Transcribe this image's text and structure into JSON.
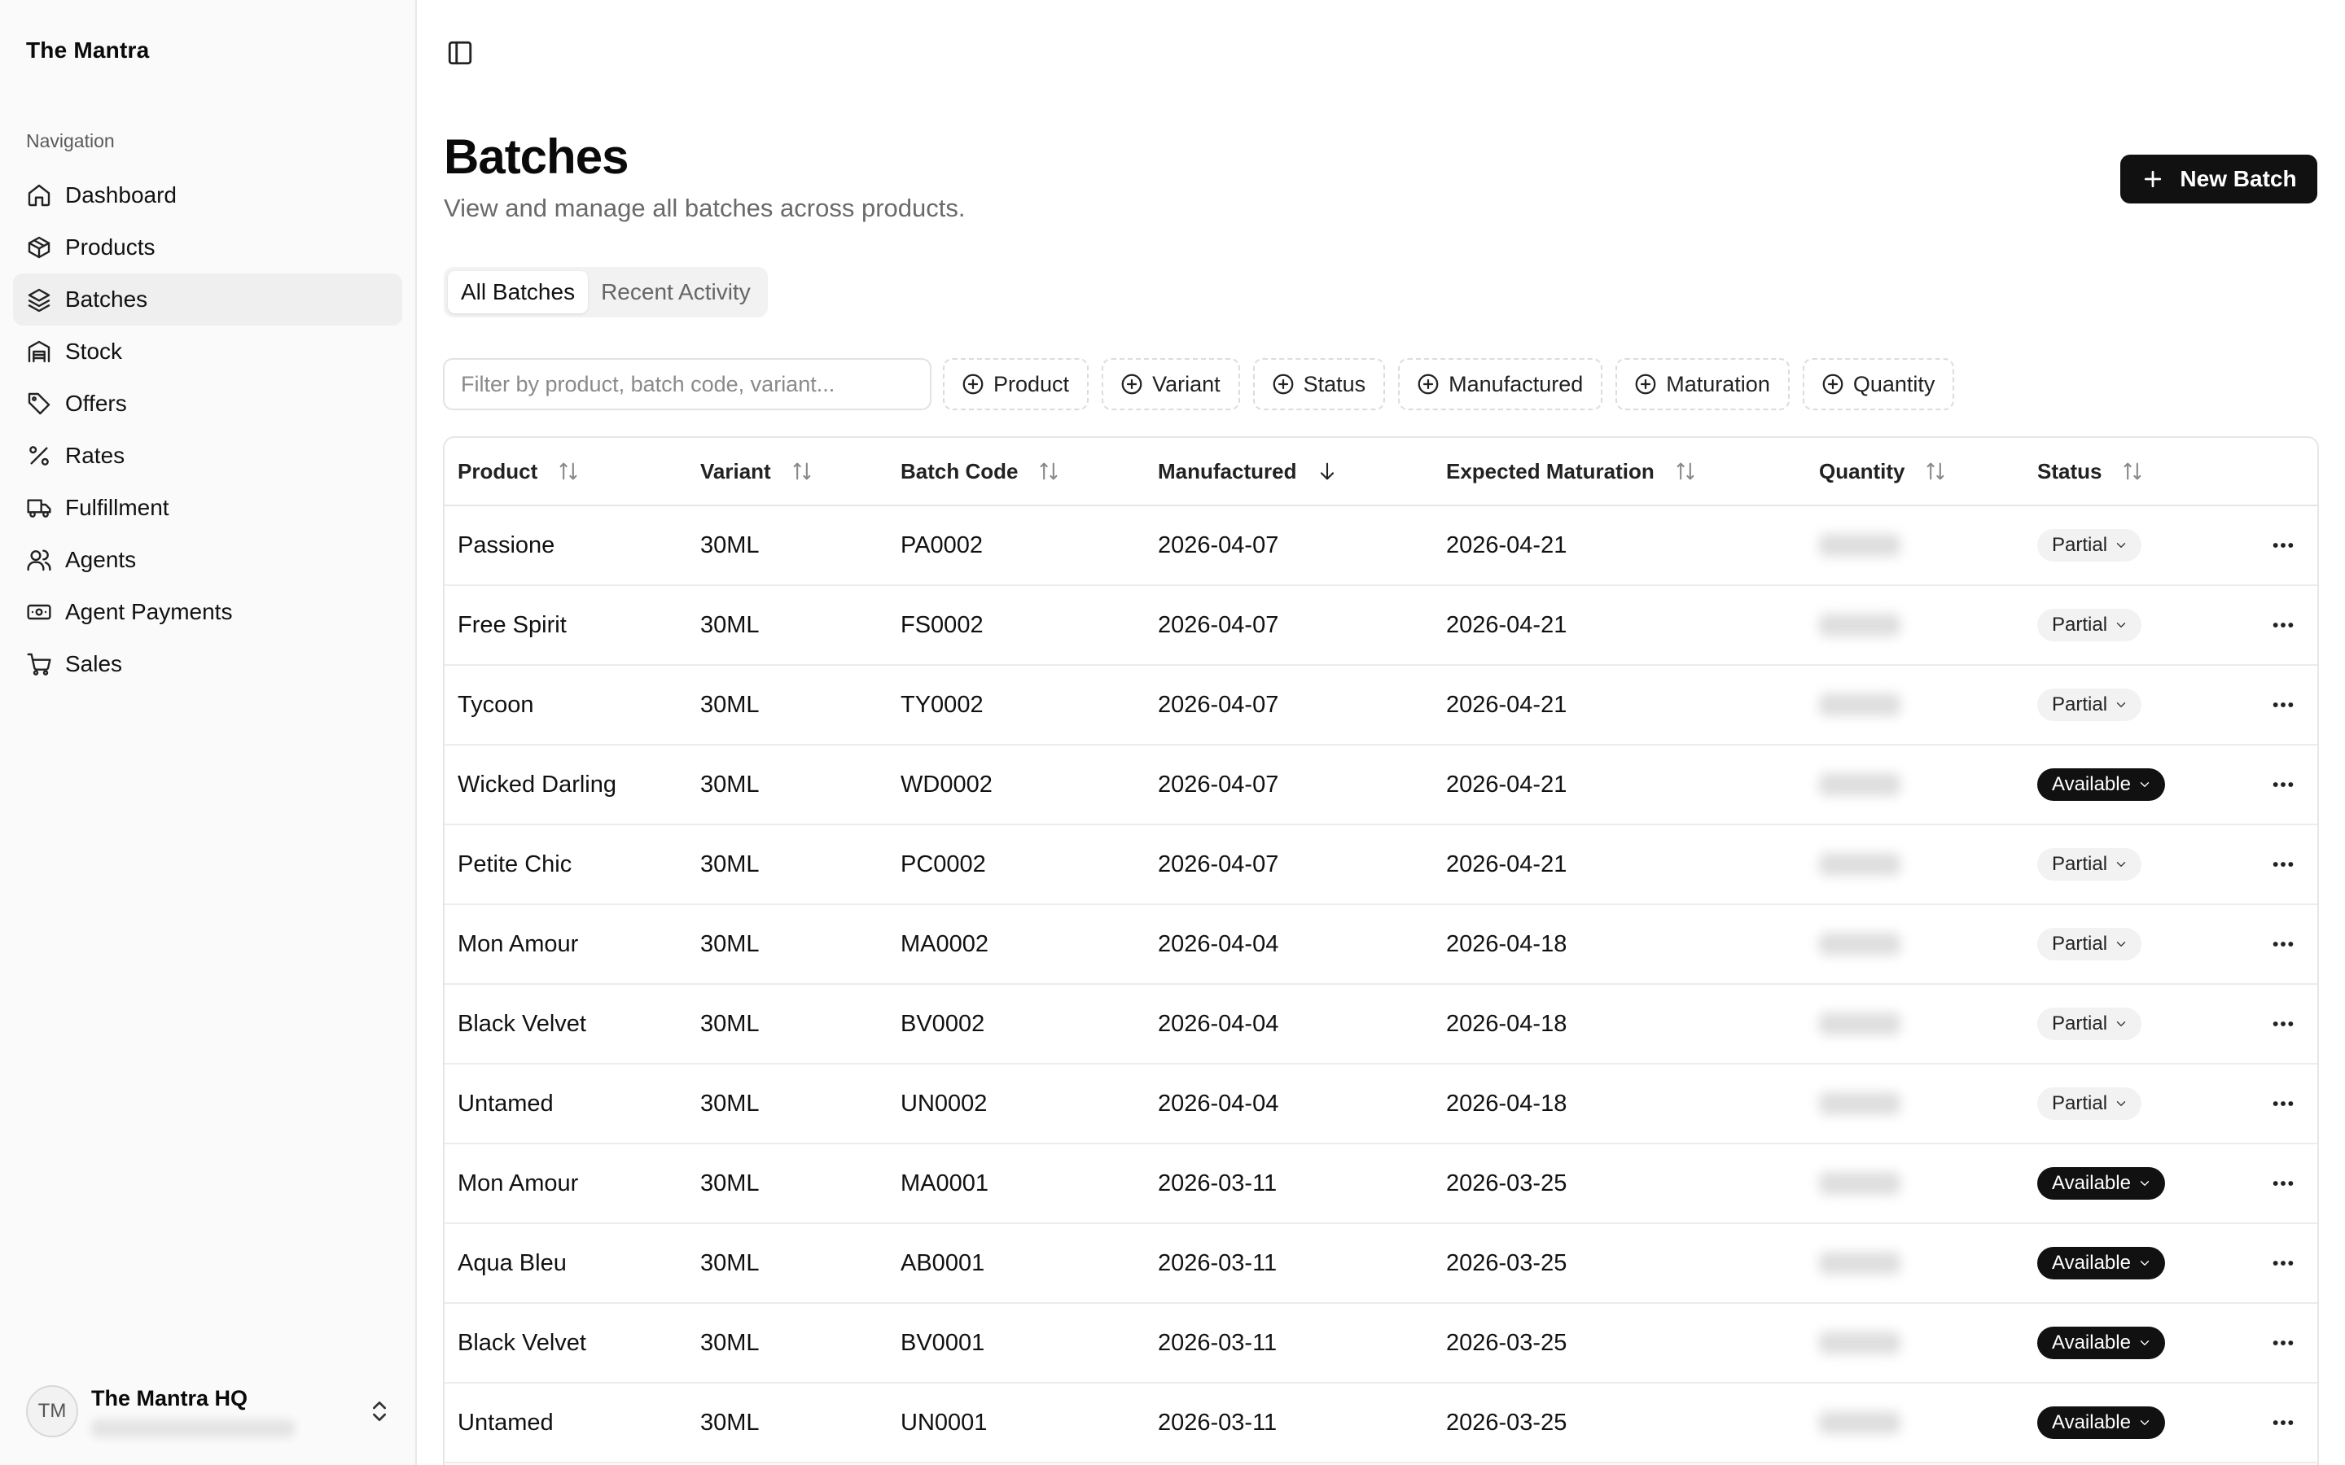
{
  "sidebar": {
    "brand": "The Mantra",
    "group_label": "Navigation",
    "items": [
      {
        "label": "Dashboard",
        "icon": "home-icon"
      },
      {
        "label": "Products",
        "icon": "package-icon"
      },
      {
        "label": "Batches",
        "icon": "layers-icon",
        "active": true
      },
      {
        "label": "Stock",
        "icon": "warehouse-icon"
      },
      {
        "label": "Offers",
        "icon": "tag-icon"
      },
      {
        "label": "Rates",
        "icon": "percent-icon"
      },
      {
        "label": "Fulfillment",
        "icon": "truck-icon"
      },
      {
        "label": "Agents",
        "icon": "users-icon"
      },
      {
        "label": "Agent Payments",
        "icon": "banknote-icon"
      },
      {
        "label": "Sales",
        "icon": "cart-icon"
      }
    ],
    "user": {
      "initials": "TM",
      "name": "The Mantra HQ"
    }
  },
  "header": {
    "title": "Batches",
    "subtitle": "View and manage all batches across products.",
    "new_button": "New Batch"
  },
  "tabs": [
    "All Batches",
    "Recent Activity"
  ],
  "filter": {
    "placeholder": "Filter by product, batch code, variant...",
    "chips": [
      "Product",
      "Variant",
      "Status",
      "Manufactured",
      "Maturation",
      "Quantity"
    ]
  },
  "table": {
    "columns": [
      "Product",
      "Variant",
      "Batch Code",
      "Manufactured",
      "Expected Maturation",
      "Quantity",
      "Status"
    ],
    "rows": [
      {
        "product": "Passione",
        "variant": "30ML",
        "code": "PA0002",
        "manufactured": "2026-04-07",
        "maturation": "2026-04-21",
        "status": "Partial"
      },
      {
        "product": "Free Spirit",
        "variant": "30ML",
        "code": "FS0002",
        "manufactured": "2026-04-07",
        "maturation": "2026-04-21",
        "status": "Partial"
      },
      {
        "product": "Tycoon",
        "variant": "30ML",
        "code": "TY0002",
        "manufactured": "2026-04-07",
        "maturation": "2026-04-21",
        "status": "Partial"
      },
      {
        "product": "Wicked Darling",
        "variant": "30ML",
        "code": "WD0002",
        "manufactured": "2026-04-07",
        "maturation": "2026-04-21",
        "status": "Available"
      },
      {
        "product": "Petite Chic",
        "variant": "30ML",
        "code": "PC0002",
        "manufactured": "2026-04-07",
        "maturation": "2026-04-21",
        "status": "Partial"
      },
      {
        "product": "Mon Amour",
        "variant": "30ML",
        "code": "MA0002",
        "manufactured": "2026-04-04",
        "maturation": "2026-04-18",
        "status": "Partial"
      },
      {
        "product": "Black Velvet",
        "variant": "30ML",
        "code": "BV0002",
        "manufactured": "2026-04-04",
        "maturation": "2026-04-18",
        "status": "Partial"
      },
      {
        "product": "Untamed",
        "variant": "30ML",
        "code": "UN0002",
        "manufactured": "2026-04-04",
        "maturation": "2026-04-18",
        "status": "Partial"
      },
      {
        "product": "Mon Amour",
        "variant": "30ML",
        "code": "MA0001",
        "manufactured": "2026-03-11",
        "maturation": "2026-03-25",
        "status": "Available"
      },
      {
        "product": "Aqua Bleu",
        "variant": "30ML",
        "code": "AB0001",
        "manufactured": "2026-03-11",
        "maturation": "2026-03-25",
        "status": "Available"
      },
      {
        "product": "Black Velvet",
        "variant": "30ML",
        "code": "BV0001",
        "manufactured": "2026-03-11",
        "maturation": "2026-03-25",
        "status": "Available"
      },
      {
        "product": "Untamed",
        "variant": "30ML",
        "code": "UN0001",
        "manufactured": "2026-03-11",
        "maturation": "2026-03-25",
        "status": "Available"
      }
    ]
  }
}
